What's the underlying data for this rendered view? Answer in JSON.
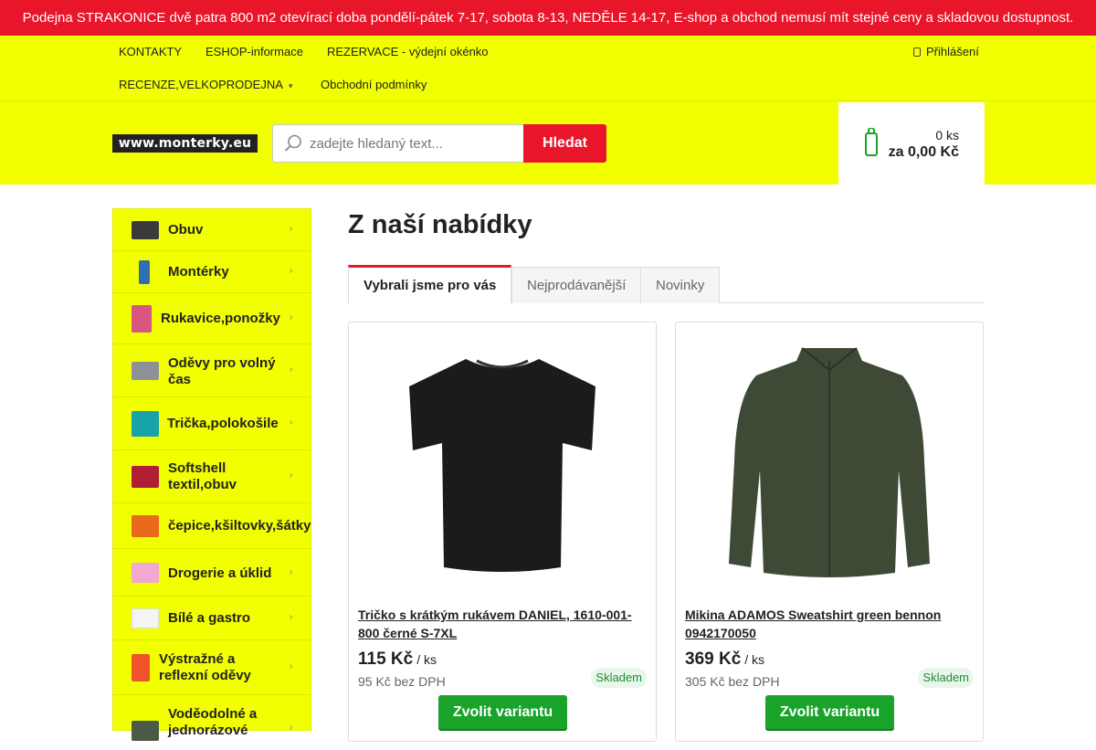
{
  "announcement": "Podejna STRAKONICE dvě patra 800 m2 otevírací doba pondělí-pátek 7-17, sobota 8-13, NEDĚLE 14-17, E-shop a obchod nemusí mít stejné ceny a skladovou dostupnost.",
  "nav": {
    "row1": [
      "KONTAKTY",
      "ESHOP-informace",
      "REZERVACE - výdejní okénko"
    ],
    "row2": [
      "RECENZE,VELKOPRODEJNA",
      "Obchodní podmínky"
    ],
    "login": "Přihlášení"
  },
  "logo_text": "www.monterky.eu",
  "search": {
    "placeholder": "zadejte hledaný text...",
    "button": "Hledat"
  },
  "cart": {
    "count": "0 ks",
    "total": "za 0,00 Kč"
  },
  "sidebar": {
    "items": [
      {
        "label": "Obuv",
        "icon": "shoe-icon"
      },
      {
        "label": "Montérky",
        "icon": "workwear-pants-icon"
      },
      {
        "label": "Rukavice,ponožky",
        "icon": "glove-icon"
      },
      {
        "label": "Oděvy pro volný čas",
        "icon": "hoodie-icon"
      },
      {
        "label": "Trička,polokošile",
        "icon": "tshirt-icon"
      },
      {
        "label": "Softshell textil,obuv",
        "icon": "softshell-jacket-icon"
      },
      {
        "label": "čepice,kšiltovky,šátky",
        "icon": "cap-icon"
      },
      {
        "label": "Drogerie a úklid",
        "icon": "drugstore-icon"
      },
      {
        "label": "Bílé a gastro",
        "icon": "chef-jacket-icon"
      },
      {
        "label": "Výstražné a reflexní oděvy",
        "icon": "reflective-vest-icon"
      },
      {
        "label": "Voděodolné a jednorázové",
        "icon": "raincoat-icon"
      }
    ]
  },
  "main": {
    "title": "Z naší nabídky",
    "tabs": [
      "Vybrali jsme pro vás",
      "Nejprodávanější",
      "Novinky"
    ],
    "products": [
      {
        "name": "Tričko s krátkým rukávem DANIEL, 1610-001-800 černé S-7XL",
        "price": "115 Kč",
        "unit": "/ ks",
        "net": "95 Kč bez DPH",
        "stock": "Skladem",
        "button": "Zvolit variantu",
        "image": "black-tshirt-image"
      },
      {
        "name": "Mikina ADAMOS Sweatshirt green bennon 0942170050",
        "price": "369 Kč",
        "unit": "/ ks",
        "net": "305 Kč bez DPH",
        "stock": "Skladem",
        "button": "Zvolit variantu",
        "image": "green-fleece-jacket-image"
      }
    ]
  },
  "colors": {
    "accent_red": "#e8152b",
    "header_yellow": "#f2ff00",
    "buy_green": "#1aa32b",
    "stock_green": "#1f8b35"
  }
}
